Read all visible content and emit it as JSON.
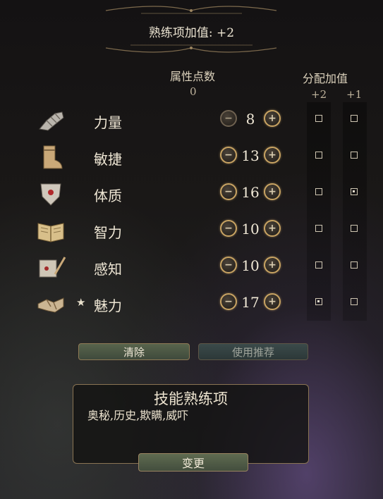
{
  "header": {
    "proficiency_bonus": "熟练项加值: +2"
  },
  "columns": {
    "points_title": "属性点数",
    "points_remaining": "0",
    "bonus_title": "分配加值",
    "bonus_plus2": "+2",
    "bonus_plus1": "+1"
  },
  "abilities": [
    {
      "name": "力量",
      "value": "8",
      "icon": "gauntlet-icon",
      "star": false,
      "plus2": false,
      "plus1": false
    },
    {
      "name": "敏捷",
      "value": "13",
      "icon": "boot-icon",
      "star": false,
      "plus2": false,
      "plus1": false
    },
    {
      "name": "体质",
      "value": "16",
      "icon": "shield-heart-icon",
      "star": false,
      "plus2": false,
      "plus1": true
    },
    {
      "name": "智力",
      "value": "10",
      "icon": "open-book-icon",
      "star": false,
      "plus2": false,
      "plus1": false
    },
    {
      "name": "感知",
      "value": "10",
      "icon": "scroll-quill-icon",
      "star": false,
      "plus2": false,
      "plus1": false
    },
    {
      "name": "魅力",
      "value": "17",
      "icon": "handshake-icon",
      "star": true,
      "plus2": true,
      "plus1": false
    }
  ],
  "star_symbol": "★",
  "minus_symbol": "−",
  "plus_symbol": "+",
  "buttons": {
    "clear": "清除",
    "recommend": "使用推荐",
    "change": "变更"
  },
  "skills": {
    "title": "技能熟练项",
    "list": "奥秘,历史,欺瞒,威吓"
  },
  "colors": {
    "gold_border": "#8f7a55",
    "text": "#e8dcc4",
    "button_green": "#58644c"
  }
}
